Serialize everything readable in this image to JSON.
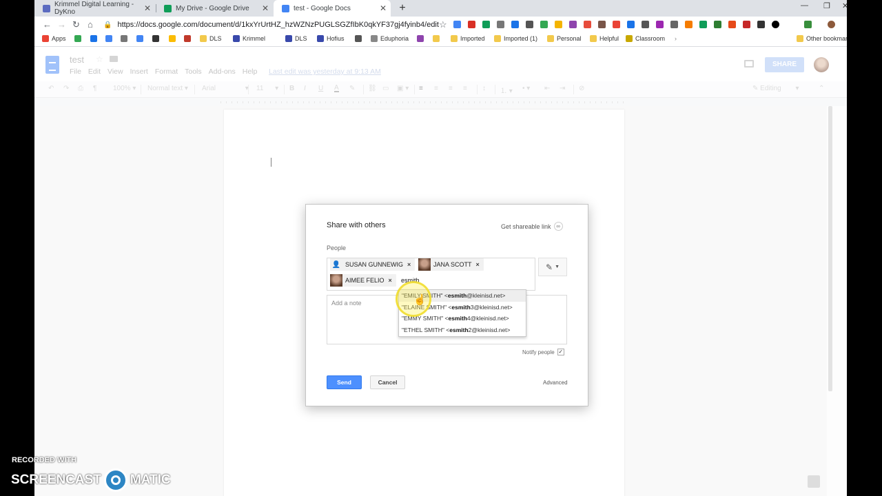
{
  "tabs": [
    {
      "title": "Krimmel Digital Learning - DyKno",
      "color": "#5b6bc0"
    },
    {
      "title": "My Drive - Google Drive",
      "color": "#0f9d58"
    },
    {
      "title": "test - Google Docs",
      "color": "#4285f4"
    }
  ],
  "address": {
    "url": "https://docs.google.com/document/d/1kxYrUrtHZ_hzWZNzPUGLSGZfIbK0qkYF37gj4fyinb4/edit"
  },
  "bookmarks": [
    {
      "label": "Apps",
      "color": "#ea4335"
    },
    {
      "label": "",
      "color": "#34a853"
    },
    {
      "label": "",
      "color": "#1a73e8"
    },
    {
      "label": "",
      "color": "#4285f4"
    },
    {
      "label": "",
      "color": "#777"
    },
    {
      "label": "",
      "color": "#4285f4"
    },
    {
      "label": "",
      "color": "#333"
    },
    {
      "label": "",
      "color": "#fbbc04"
    },
    {
      "label": "",
      "color": "#c0392b"
    },
    {
      "label": "DLS",
      "color": "#f2c94c"
    },
    {
      "label": "Krimmel",
      "color": "#3949ab"
    },
    {
      "label": "DLS",
      "color": "#3949ab"
    },
    {
      "label": "Hofius",
      "color": "#3949ab"
    },
    {
      "label": "",
      "color": "#555"
    },
    {
      "label": "Eduphoria",
      "color": "#888"
    },
    {
      "label": "",
      "color": "#8e44ad"
    },
    {
      "label": "",
      "color": "#f2c94c"
    },
    {
      "label": "Imported",
      "color": "#f2c94c"
    },
    {
      "label": "Imported (1)",
      "color": "#f2c94c"
    },
    {
      "label": "Personal",
      "color": "#f2c94c"
    },
    {
      "label": "Helpful",
      "color": "#f2c94c"
    },
    {
      "label": "Classroom",
      "color": "#c8a800"
    },
    {
      "label": "Other bookmar",
      "color": "#f2c94c"
    }
  ],
  "doc": {
    "title": "test",
    "menu": [
      "File",
      "Edit",
      "View",
      "Insert",
      "Format",
      "Tools",
      "Add-ons",
      "Help"
    ],
    "last_edit": "Last edit was yesterday at 9:13 AM",
    "share_label": "SHARE"
  },
  "toolbar": {
    "zoom": "100%",
    "style": "Normal text",
    "font": "Arial",
    "size": "11",
    "mode": "Editing"
  },
  "dialog": {
    "title": "Share with others",
    "shareable_link": "Get shareable link",
    "people_label": "People",
    "chips": [
      {
        "name": "SUSAN GUNNEWIG",
        "avatar": "person-icon"
      },
      {
        "name": "JANA SCOTT",
        "avatar": "photo"
      },
      {
        "name": "AIMEE FELIO",
        "avatar": "photo"
      }
    ],
    "typed": "esmith",
    "note_placeholder": "Add a note",
    "notify_label": "Notify people",
    "send": "Send",
    "cancel": "Cancel",
    "advanced": "Advanced"
  },
  "suggestions": [
    {
      "pre": "\"EMILY SMITH\" <",
      "bold": "esmith",
      "post": "@kleinisd.net>",
      "highlighted": true
    },
    {
      "pre": "\"ELAINE SMITH\" <",
      "bold": "esmith",
      "post": "3@kleinisd.net>",
      "highlighted": false
    },
    {
      "pre": "\"EMMY SMITH\" <",
      "bold": "esmith",
      "post": "4@kleinisd.net>",
      "highlighted": false
    },
    {
      "pre": "\"ETHEL SMITH\" <",
      "bold": "esmith",
      "post": "2@kleinisd.net>",
      "highlighted": false
    }
  ],
  "watermark": {
    "line1": "RECORDED WITH",
    "line2a": "SCREENCAST",
    "line2b": "MATIC"
  }
}
